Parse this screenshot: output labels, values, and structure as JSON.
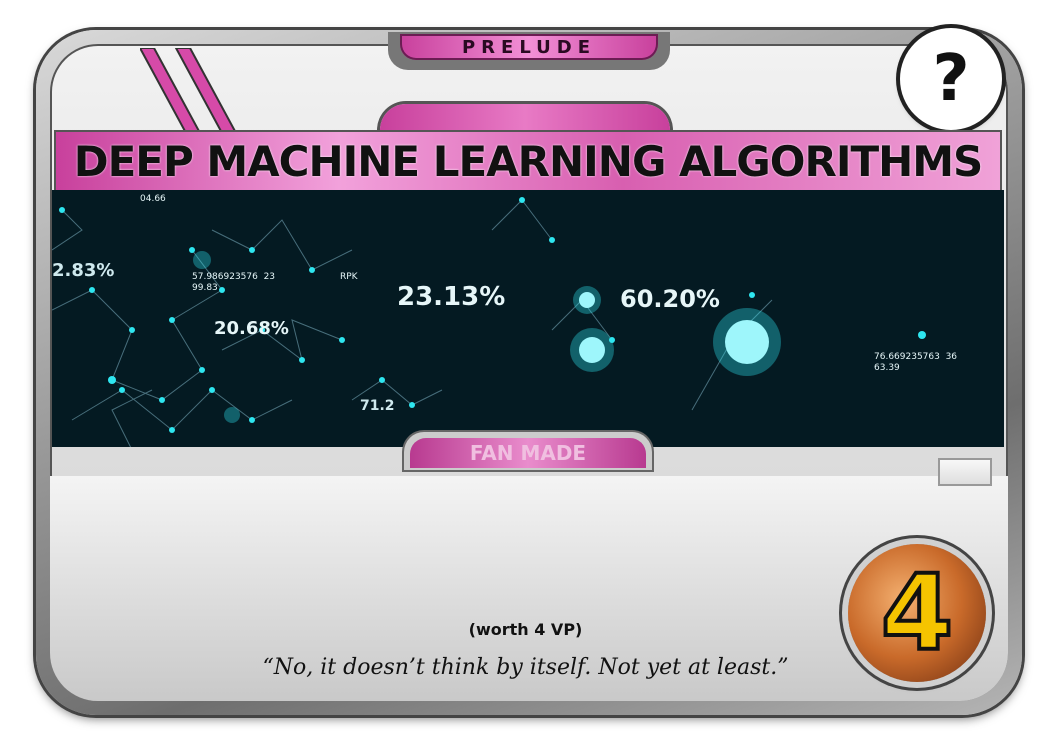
{
  "card": {
    "header_label": "PRELUDE",
    "help_badge": "?",
    "title": "DEEP MACHINE LEARNING ALGORITHMS",
    "tag": "FAN MADE",
    "effect_note": "(worth 4 VP)",
    "flavor_text": "“No, it doesn’t think by itself. Not yet at least.”",
    "victory_points": "4"
  },
  "art_text": {
    "stat_1": "23.13%",
    "stat_2": "60.20%",
    "stat_3": "20.68%",
    "stat_4": "2.83%",
    "readout_1": "57.986923576  23",
    "readout_1b": "99.83",
    "readout_1c": "RPK",
    "readout_2": "76.669235763  36",
    "readout_2b": "63.39",
    "readout_3": "04.66",
    "readout_4": "71.2"
  },
  "colors": {
    "accent_magenta": "#c8409c",
    "art_background": "#041a22",
    "node_cyan": "#2ee6f0",
    "vp_yellow": "#f5c400"
  }
}
